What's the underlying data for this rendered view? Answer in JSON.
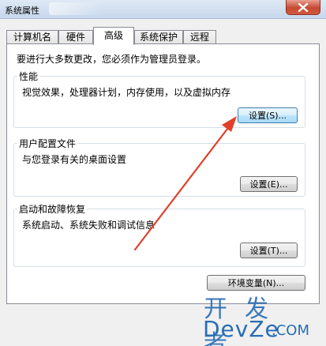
{
  "window": {
    "title": "系统属性",
    "close_icon": "close-icon"
  },
  "tabs": [
    {
      "label": "计算机名",
      "active": false
    },
    {
      "label": "硬件",
      "active": false
    },
    {
      "label": "高级",
      "active": true
    },
    {
      "label": "系统保护",
      "active": false
    },
    {
      "label": "远程",
      "active": false
    }
  ],
  "advanced": {
    "intro": "要进行大多数更改，您必须作为管理员登录。",
    "performance": {
      "title": "性能",
      "description": "视觉效果，处理器计划，内存使用，以及虚拟内存",
      "button": "设置(S)..."
    },
    "user_profiles": {
      "title": "用户配置文件",
      "description": "与您登录有关的桌面设置",
      "button": "设置(E)..."
    },
    "startup_recovery": {
      "title": "启动和故障恢复",
      "description": "系统启动、系统失败和调试信息",
      "button": "设置(T)..."
    },
    "env_button": "环境变量(N)..."
  },
  "watermark": {
    "cn": "开发者",
    "en": "DevZe",
    "dot": ".COM"
  },
  "colors": {
    "annotation_arrow": "#e0402a",
    "watermark": "#2a6db4",
    "close_button": "#c74a32"
  }
}
